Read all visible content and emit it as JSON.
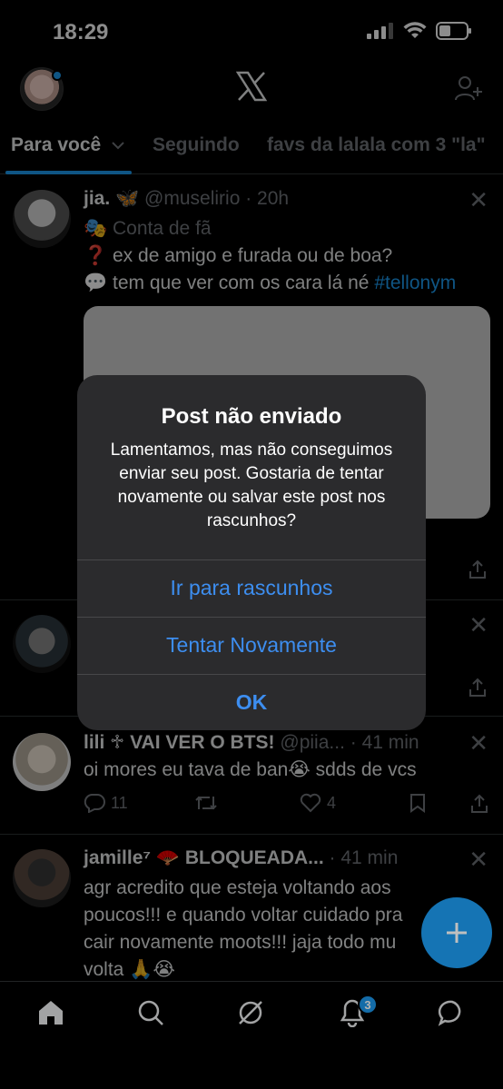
{
  "status": {
    "time": "18:29"
  },
  "tabs": [
    {
      "label": "Para você"
    },
    {
      "label": "Seguindo"
    },
    {
      "label": "favs da lalala com 3 \"la\""
    }
  ],
  "posts": [
    {
      "name": "jia.",
      "handle": "@muselirio",
      "time": "· 20h",
      "label": "Conta de fã",
      "line1": "ex de amigo e furada ou de boa?",
      "line2": "tem que ver com os cara lá né",
      "hashtag": "#tellonym"
    },
    {
      "name": "lili ♱ VAI VER O BTS!",
      "handle": "@piia...",
      "time": "· 41 min",
      "text": "oi mores eu tava de ban😭 sdds de vcs",
      "replies": "11",
      "likes": "4"
    },
    {
      "name": "jamille⁷ 🪭 BLOQUEADA...",
      "time": "· 41 min",
      "text": "agr acredito que esteja voltando aos poucos!!! e quando voltar cuidado pra cair novamente moots!!! jaja todo mu volta 🙏😭"
    }
  ],
  "dialog": {
    "title": "Post não enviado",
    "message": "Lamentamos, mas não conseguimos enviar seu post. Gostaria de tentar novamente ou salvar este post nos rascunhos?",
    "buttons": [
      "Ir para rascunhos",
      "Tentar Novamente",
      "OK"
    ]
  },
  "nav": {
    "notifications_badge": "3"
  },
  "colors": {
    "accent": "#1d9bf0",
    "dialog_link": "#3d8ef0",
    "muted": "#71767b"
  }
}
